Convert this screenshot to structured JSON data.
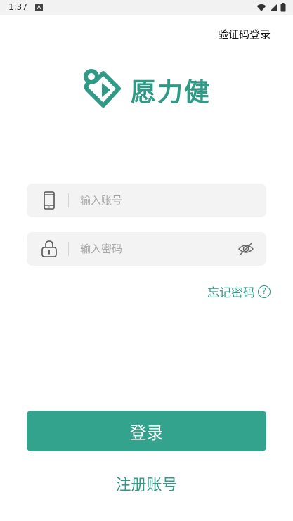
{
  "status_bar": {
    "time": "1:37",
    "notification_letter": "A",
    "icons": [
      "wifi-icon",
      "signal-icon",
      "battery-icon"
    ]
  },
  "header": {
    "sms_login_label": "验证码登录"
  },
  "brand": {
    "name": "愿力健",
    "color": "#2f9a86"
  },
  "form": {
    "account": {
      "placeholder": "输入账号",
      "value": "",
      "icon": "phone-icon"
    },
    "password": {
      "placeholder": "输入密码",
      "value": "",
      "icon": "lock-icon",
      "toggle_icon": "eye-hidden-icon"
    },
    "forgot_label": "忘记密码",
    "forgot_icon": "question-icon",
    "help_glyph": "?"
  },
  "actions": {
    "login_label": "登录",
    "login_color": "#33a38e",
    "register_label": "注册账号"
  }
}
